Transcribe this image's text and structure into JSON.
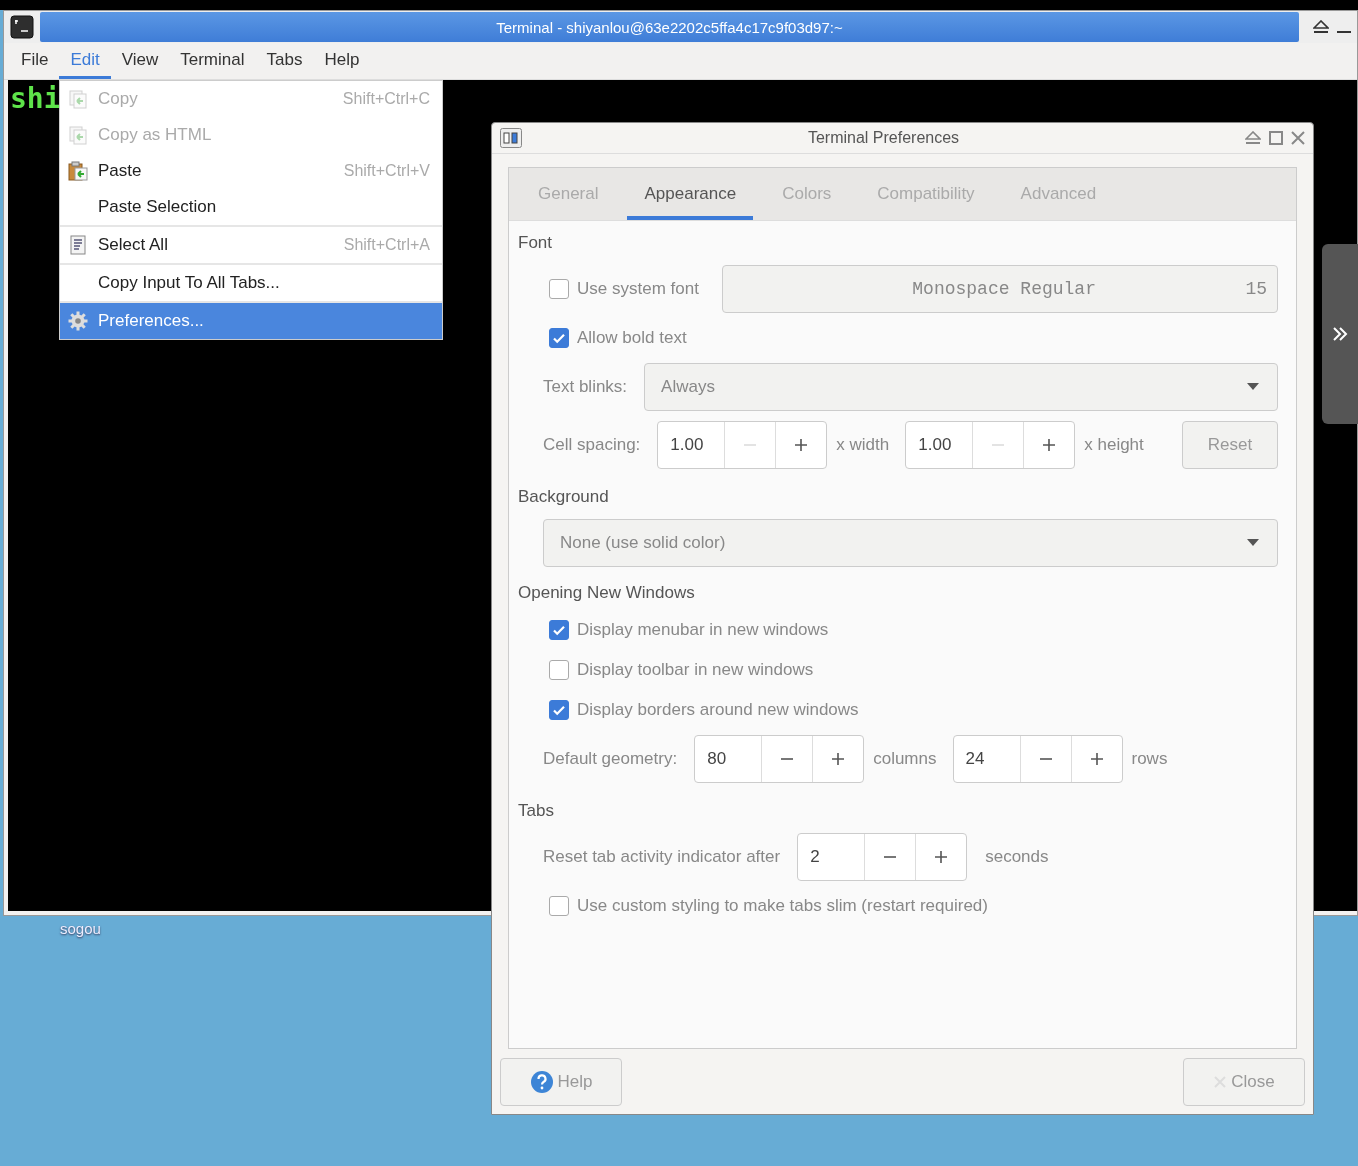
{
  "desktop": {
    "icon_label": "sogou"
  },
  "terminal_window": {
    "title": "Terminal - shiyanlou@63e2202c5ffa4c17c9f03d97:~",
    "prompt": "shi",
    "menu": [
      {
        "label": "File",
        "selected": false
      },
      {
        "label": "Edit",
        "selected": true
      },
      {
        "label": "View",
        "selected": false
      },
      {
        "label": "Terminal",
        "selected": false
      },
      {
        "label": "Tabs",
        "selected": false
      },
      {
        "label": "Help",
        "selected": false
      }
    ]
  },
  "edit_menu": {
    "items": [
      {
        "kind": "copy",
        "label": "Copy",
        "shortcut": "Shift+Ctrl+C",
        "disabled": true,
        "selected": false,
        "separator": false
      },
      {
        "kind": "copy",
        "label": "Copy as HTML",
        "disabled": true,
        "selected": false,
        "separator": false
      },
      {
        "kind": "paste",
        "label": "Paste",
        "shortcut": "Shift+Ctrl+V",
        "disabled": false,
        "selected": false,
        "separator": false
      },
      {
        "kind": "plain",
        "label": "Paste Selection",
        "disabled": false,
        "selected": false,
        "separator": true
      },
      {
        "kind": "select",
        "label": "Select All",
        "shortcut": "Shift+Ctrl+A",
        "disabled": false,
        "selected": false,
        "separator": true
      },
      {
        "kind": "plain",
        "label": "Copy Input To All Tabs...",
        "disabled": false,
        "selected": false,
        "separator": true
      },
      {
        "kind": "settings",
        "label": "Preferences...",
        "disabled": false,
        "selected": true,
        "separator": false
      }
    ]
  },
  "preferences_dialog": {
    "title": "Terminal Preferences",
    "tabs": [
      {
        "label": "General",
        "selected": false
      },
      {
        "label": "Appearance",
        "selected": true
      },
      {
        "label": "Colors",
        "selected": false
      },
      {
        "label": "Compatibility",
        "selected": false
      },
      {
        "label": "Advanced",
        "selected": false
      }
    ],
    "font": {
      "heading": "Font",
      "use_system_font": {
        "label": "Use system font",
        "checked": false
      },
      "font_name": "Monospace Regular",
      "font_size": "15",
      "allow_bold": {
        "label": "Allow bold text",
        "checked": true
      },
      "text_blinks_label": "Text blinks:",
      "text_blinks_value": "Always",
      "cell_spacing_label": "Cell spacing:",
      "width_value": "1.00",
      "width_minus_disabled": true,
      "width_unit": "x width",
      "height_value": "1.00",
      "height_minus_disabled": true,
      "height_unit": "x height",
      "reset_button": "Reset"
    },
    "background": {
      "heading": "Background",
      "value": "None (use solid color)"
    },
    "new_windows": {
      "heading": "Opening New Windows",
      "checkboxes": [
        {
          "label": "Display menubar in new windows",
          "checked": true
        },
        {
          "label": "Display toolbar in new windows",
          "checked": false
        },
        {
          "label": "Display borders around new windows",
          "checked": true
        }
      ],
      "geometry_label": "Default geometry:",
      "columns_value": "80",
      "columns_minus_disabled": false,
      "columns_unit": "columns",
      "rows_value": "24",
      "rows_minus_disabled": false,
      "rows_unit": "rows"
    },
    "tabs_section": {
      "heading": "Tabs",
      "reset_label": "Reset tab activity indicator after",
      "reset_value": "2",
      "reset_minus_disabled": false,
      "reset_unit": "seconds",
      "slim_tabs": {
        "label": "Use custom styling to make tabs slim (restart required)",
        "checked": false
      }
    },
    "help_button": "Help",
    "close_button": "Close"
  }
}
